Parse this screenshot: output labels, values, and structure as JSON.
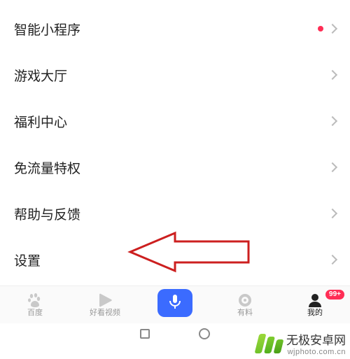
{
  "list": {
    "items": [
      {
        "label": "智能小程序",
        "hasDot": true
      },
      {
        "label": "游戏大厅",
        "hasDot": false
      },
      {
        "label": "福利中心",
        "hasDot": false
      },
      {
        "label": "免流量特权",
        "hasDot": false
      },
      {
        "label": "帮助与反馈",
        "hasDot": false
      },
      {
        "label": "设置",
        "hasDot": false
      }
    ]
  },
  "tabbar": {
    "tabs": [
      {
        "name": "baidu",
        "label": "百度",
        "active": false
      },
      {
        "name": "haokan",
        "label": "好看视频",
        "active": false
      },
      {
        "name": "mic",
        "label": "",
        "active": false
      },
      {
        "name": "youliao",
        "label": "有料",
        "active": false
      },
      {
        "name": "wode",
        "label": "我的",
        "active": true,
        "badge": "99+"
      }
    ]
  },
  "watermark": {
    "title": "无极安卓网",
    "url": "wjphoto.com.cn"
  },
  "colors": {
    "accent": "#3b6bff",
    "badge": "#ff2d55",
    "dot": "#ff2d55",
    "arrow": "#cc1f1f"
  }
}
